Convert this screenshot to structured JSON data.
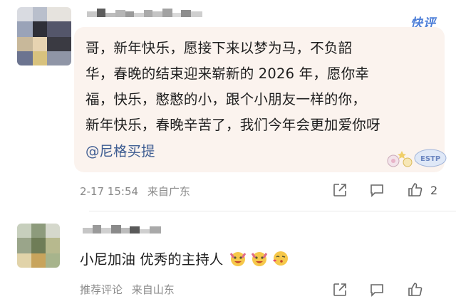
{
  "brand": {
    "label": "快评"
  },
  "comments": [
    {
      "username_blurred": true,
      "text": "哥，新年快乐，愿接下来以梦为马，不负韶华，春晚的结束迎来崭新的 2026 年，愿你幸福，快乐，憨憨的小，跟个小朋友一样的你，新年快乐，春晚辛苦了，我们今年会更加爱你呀",
      "lines": [
        "哥，新年快乐，愿接下来以梦为马，不负韶",
        "华，春晚的结束迎来崭新的 2026 年，愿你幸",
        "福，快乐，憨憨的小，跟个小朋友一样的你，",
        "新年快乐，春晚辛苦了，我们今年会更加爱你呀"
      ],
      "mention": "@尼格买提",
      "time": "2-17 15:54",
      "location": "来自广东",
      "like_count": "2",
      "icons": [
        "share-icon",
        "comment-icon",
        "like-icon"
      ]
    },
    {
      "username_blurred": true,
      "text": "小尼加油 优秀的主持人",
      "label": "推荐评论",
      "location": "来自山东",
      "emojis": [
        "cheering-emoji",
        "cheering-emoji",
        "kiss-emoji"
      ],
      "icons": [
        "share-icon",
        "comment-icon",
        "like-icon"
      ]
    }
  ],
  "colors": {
    "accent": "#4e7fd8",
    "mention": "#3f5d92",
    "bubble": "#fbf3ee",
    "meta": "#8a8a8a"
  }
}
